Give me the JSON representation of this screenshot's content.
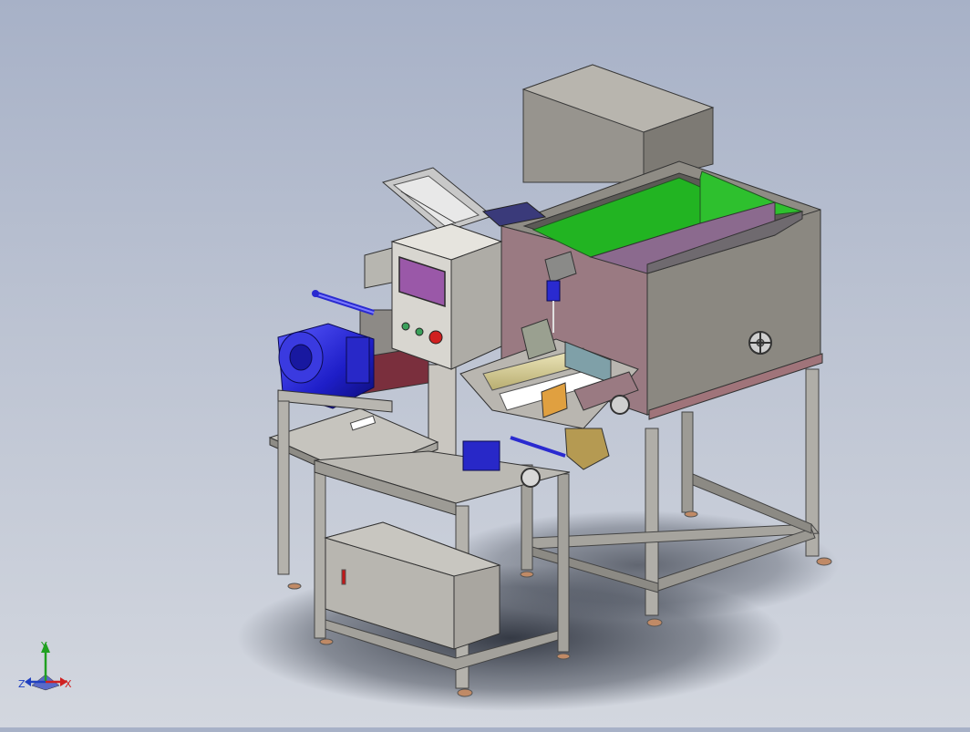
{
  "viewport": {
    "background_top": "#a7b1c7",
    "background_bottom": "#d3d7df"
  },
  "triad": {
    "x_label": "X",
    "y_label": "Y",
    "z_label": "Z",
    "x_color": "#d02020",
    "y_color": "#20a020",
    "z_color": "#2040c0"
  },
  "model": {
    "frame_color": "#a9a7a2",
    "housing_color": "#8f8c85",
    "hopper_inner_color": "#22b422",
    "hopper_lid_color": "#9a7a82",
    "motor_color": "#2a2ad0",
    "panel_screen_color": "#9a58a8",
    "panel_start_color": "#3aa05a",
    "panel_stop_color": "#d02020",
    "roller_color": "#d8d09a"
  }
}
